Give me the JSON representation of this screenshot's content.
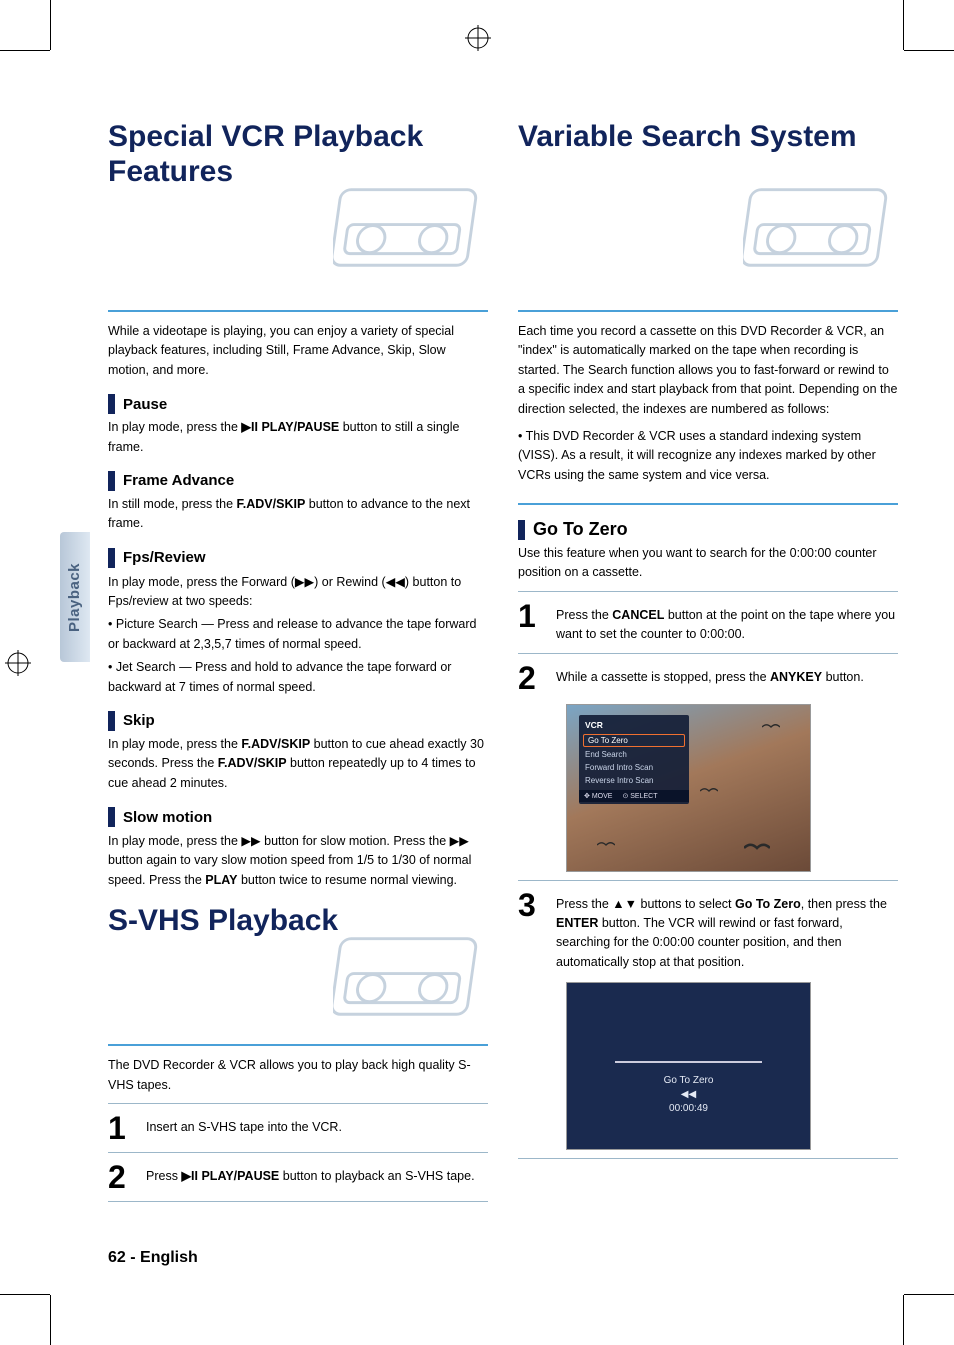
{
  "domain": "Document",
  "sidebar": {
    "tab_label": "Playback"
  },
  "left": {
    "title": "Special VCR Playback Features",
    "intro": "While a videotape is playing, you can enjoy a variety of special playback features, including Still, Frame Advance, Skip, Slow motion, and more.",
    "pause": {
      "heading": "Pause",
      "text_before": "In play mode, press the ",
      "button": "▶II PLAY/PAUSE",
      "text_after": " button to still a single frame."
    },
    "frame": {
      "heading": "Frame Advance",
      "text_before": "In still mode, press the ",
      "button": "F.ADV/SKIP",
      "text_after": " button to advance to the next frame."
    },
    "fps": {
      "heading": "Fps/Review",
      "line1_a": "In play mode, press the Forward (",
      "sym_ff": "▶▶",
      "line1_b": ") or Rewind (",
      "sym_rw": "◀◀",
      "line1_c": ") button to Fps/review at two speeds:",
      "bullet1": "Picture Search — Press and release to advance the tape forward or backward at 2,3,5,7 times of normal speed.",
      "bullet2": "Jet Search — Press and hold to advance the tape forward or backward at 7 times of normal speed."
    },
    "skip": {
      "heading": "Skip",
      "text": "In play mode, press the F.ADV/SKIP button to cue ahead exactly 30 seconds. Press the F.ADV/SKIP button repeatedly up to 4 times to cue ahead 2 minutes."
    },
    "slow": {
      "heading": "Slow motion",
      "text": "In play mode, press the ▶▶ button for slow motion. Press the ▶▶ button again to vary slow motion speed from 1/5 to 1/30 of normal speed. Press the PLAY button twice to resume normal viewing.",
      "btn_ff": "▶▶",
      "btn_play": "PLAY"
    },
    "svhs": {
      "title": "S-VHS Playback",
      "intro": "The DVD Recorder & VCR allows you to play back high quality S-VHS tapes.",
      "step1": "Insert an S-VHS tape into the VCR.",
      "step2_a": "Press ",
      "step2_btn": "▶II  PLAY/PAUSE",
      "step2_b": " button to playback an S-VHS tape."
    }
  },
  "right": {
    "title": "Variable Search System",
    "intro": "Each time you record a cassette on this DVD Recorder & VCR, an \"index\" is automatically marked on the tape when recording is started. The Search function allows you to fast-forward or rewind to a specific index and start playback from that point. Depending on the direction selected, the indexes are numbered as follows:",
    "note": "• This DVD Recorder & VCR uses a standard indexing system (VISS). As a result, it will recognize any indexes marked by other VCRs using the same system and vice versa.",
    "gotozero": {
      "heading": "Go To Zero",
      "text": "Use this feature when you want to search for the 0:00:00 counter position on a cassette.",
      "step1_a": "Press the ",
      "step1_btn": "CANCEL",
      "step1_b": " button at the point on the tape where you want to set the counter to 0:00:00.",
      "step2_a": "While a cassette is stopped, press the ",
      "step2_btn": "ANYKEY",
      "step2_b": " button.",
      "step3_a": "Press the ",
      "step3_sym": "▲▼",
      "step3_b": " buttons to select ",
      "step3_item": "Go To Zero",
      "step3_c": ", then press the ",
      "step3_btn": "ENTER",
      "step3_d": " button. The VCR will rewind or fast forward, searching for the 0:00:00 counter position, and then automatically stop at that position."
    },
    "menu": {
      "header": "VCR",
      "items": [
        "Go To Zero",
        "End Search",
        "Forward Intro Scan",
        "Reverse Intro Scan"
      ],
      "footer_move": "MOVE",
      "footer_select": "SELECT"
    },
    "status": {
      "label": "Go To Zero",
      "icon": "◀◀",
      "time": "00:00:49"
    }
  },
  "page_number": "62 - English"
}
